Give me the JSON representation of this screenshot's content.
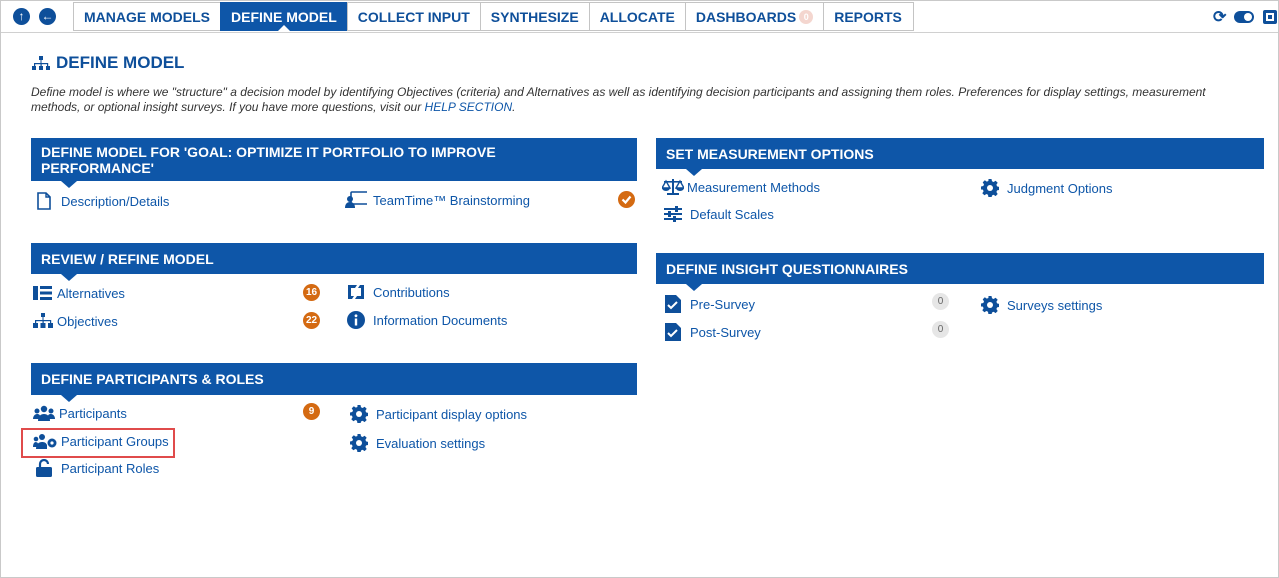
{
  "nav": {
    "tabs": [
      "MANAGE MODELS",
      "DEFINE MODEL",
      "COLLECT INPUT",
      "SYNTHESIZE",
      "ALLOCATE",
      "DASHBOARDS",
      "REPORTS"
    ],
    "active_tab": "DEFINE MODEL",
    "dashboards_badge": "0"
  },
  "page": {
    "title": "DEFINE MODEL",
    "description": "Define model is where we \"structure\" a decision model by identifying Objectives (criteria) and Alternatives as well as identifying decision participants and assigning them roles. Preferences for display settings, measurement methods, or optional insight surveys. If you have more questions, visit our ",
    "help_link": "HELP SECTION",
    "description_end": "."
  },
  "define_model": {
    "heading": "DEFINE MODEL FOR 'GOAL: OPTIMIZE IT PORTFOLIO TO IMPROVE PERFORMANCE'",
    "description_details": "Description/Details",
    "teamtime": "TeamTime™ Brainstorming"
  },
  "review": {
    "heading": "REVIEW / REFINE MODEL",
    "alternatives": "Alternatives",
    "alternatives_count": "16",
    "objectives": "Objectives",
    "objectives_count": "22",
    "contributions": "Contributions",
    "information_documents": "Information Documents"
  },
  "participants": {
    "heading": "DEFINE PARTICIPANTS & ROLES",
    "participants": "Participants",
    "participants_count": "9",
    "participant_groups": "Participant Groups",
    "participant_roles": "Participant Roles",
    "display_options": "Participant display options",
    "evaluation_settings": "Evaluation settings"
  },
  "measurement": {
    "heading": "SET MEASUREMENT OPTIONS",
    "methods": "Measurement Methods",
    "scales": "Default Scales",
    "judgment": "Judgment Options"
  },
  "insight": {
    "heading": "DEFINE INSIGHT QUESTIONNAIRES",
    "pre_survey": "Pre-Survey",
    "pre_count": "0",
    "post_survey": "Post-Survey",
    "post_count": "0",
    "surveys_settings": "Surveys settings"
  },
  "colors": {
    "primary": "#0e56a8",
    "badge": "#d46a12",
    "highlight": "#e04b4b"
  }
}
